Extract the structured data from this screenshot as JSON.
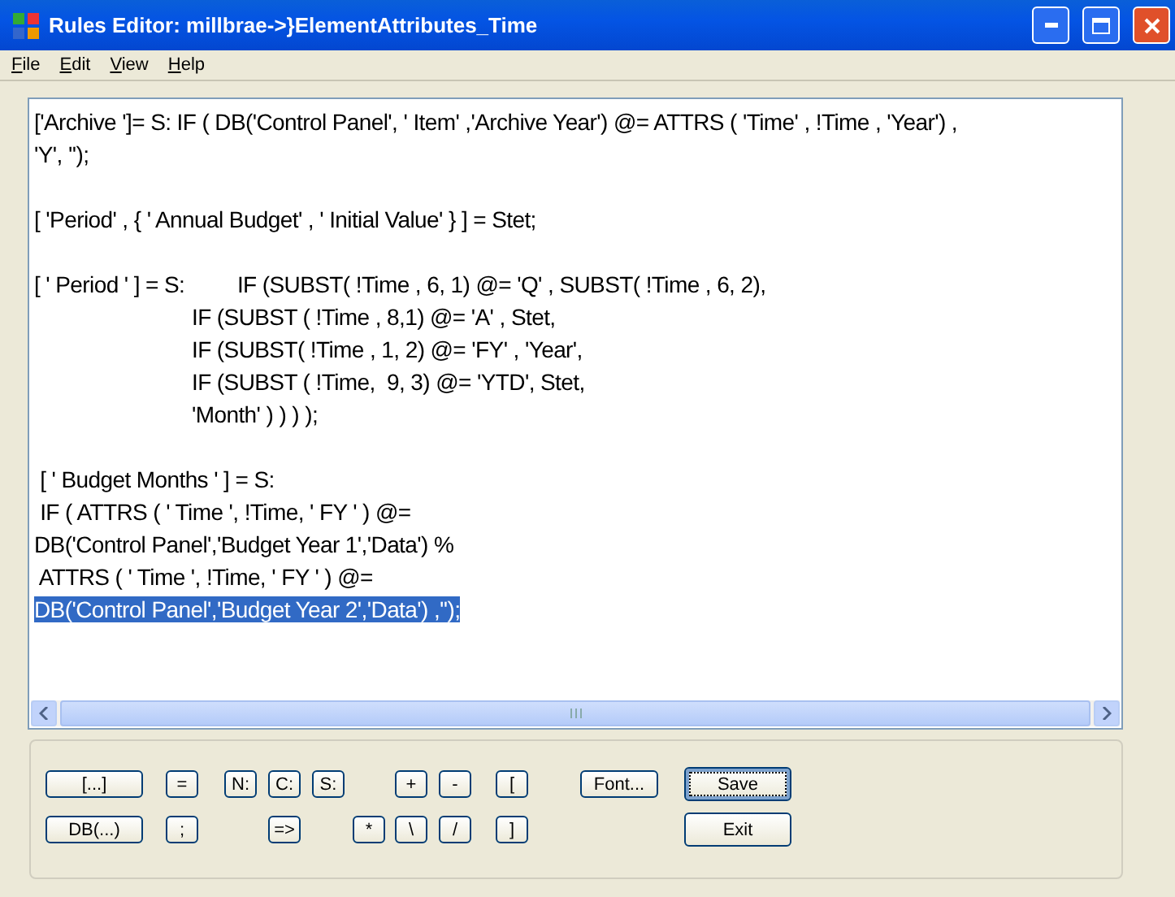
{
  "window": {
    "title": "Rules Editor:  millbrae->}ElementAttributes_Time"
  },
  "menu": [
    {
      "label": "File"
    },
    {
      "label": "Edit"
    },
    {
      "label": "View"
    },
    {
      "label": "Help"
    }
  ],
  "editor": {
    "paragraphs": [
      [
        {
          "text": "['Archive ']= S: IF ( DB('Control Panel', ' Item' ,'Archive Year') @= ATTRS ( 'Time' , !Time , 'Year') ,",
          "kind": "plain",
          "selected": false
        },
        {
          "text": "'Y', '');",
          "kind": "plain",
          "selected": false
        }
      ],
      [
        {
          "text": "[ 'Period' , { ' Annual Budget' , ' Initial Value' } ] = Stet;",
          "kind": "plain",
          "selected": false
        }
      ],
      [
        {
          "text": "[ ' Period ' ] = S:         IF (SUBST( !Time , 6, 1) @= 'Q' , SUBST( !Time , 6, 2),",
          "kind": "plain",
          "selected": false
        },
        {
          "text": "IF (SUBST ( !Time , 8,1) @= 'A' , Stet,",
          "kind": "indented",
          "selected": false
        },
        {
          "text": "IF (SUBST( !Time , 1, 2) @= 'FY' , 'Year',",
          "kind": "indented",
          "selected": false
        },
        {
          "text": "IF (SUBST ( !Time,  9, 3) @= 'YTD', Stet,",
          "kind": "indented",
          "selected": false
        },
        {
          "text": "'Month' ) ) ) );",
          "kind": "indented",
          "selected": false
        }
      ],
      [
        {
          "text": " [ ' Budget Months ' ] = S:",
          "kind": "plain",
          "selected": false
        },
        {
          "text": " IF ( ATTRS ( ' Time ', !Time, ' FY ' ) @=",
          "kind": "plain",
          "selected": false
        },
        {
          "text": "DB('Control Panel','Budget Year 1','Data') %",
          "kind": "plain",
          "selected": false
        },
        {
          "text": " ATTRS ( ' Time ', !Time, ' FY ' ) @=",
          "kind": "plain",
          "selected": false
        },
        {
          "text": "DB('Control Panel','Budget Year 2','Data') ,'');",
          "kind": "plain",
          "selected": true
        }
      ]
    ]
  },
  "buttons": [
    {
      "label": "[...]",
      "focused": false
    },
    {
      "label": "=",
      "focused": false
    },
    {
      "label": "N:",
      "focused": false
    },
    {
      "label": "C:",
      "focused": false
    },
    {
      "label": "S:",
      "focused": false
    },
    {
      "label": "+",
      "focused": false
    },
    {
      "label": "-",
      "focused": false
    },
    {
      "label": "[",
      "focused": false
    },
    {
      "label": "Font...",
      "focused": false
    },
    {
      "label": "Save",
      "focused": true
    },
    {
      "label": "DB(...)",
      "focused": false
    },
    {
      "label": ";",
      "focused": false
    },
    {
      "label": "=>",
      "focused": false
    },
    {
      "label": "*",
      "focused": false
    },
    {
      "label": "\\",
      "focused": false
    },
    {
      "label": "/",
      "focused": false
    },
    {
      "label": "]",
      "focused": false
    },
    {
      "label": "Exit",
      "focused": false
    }
  ]
}
